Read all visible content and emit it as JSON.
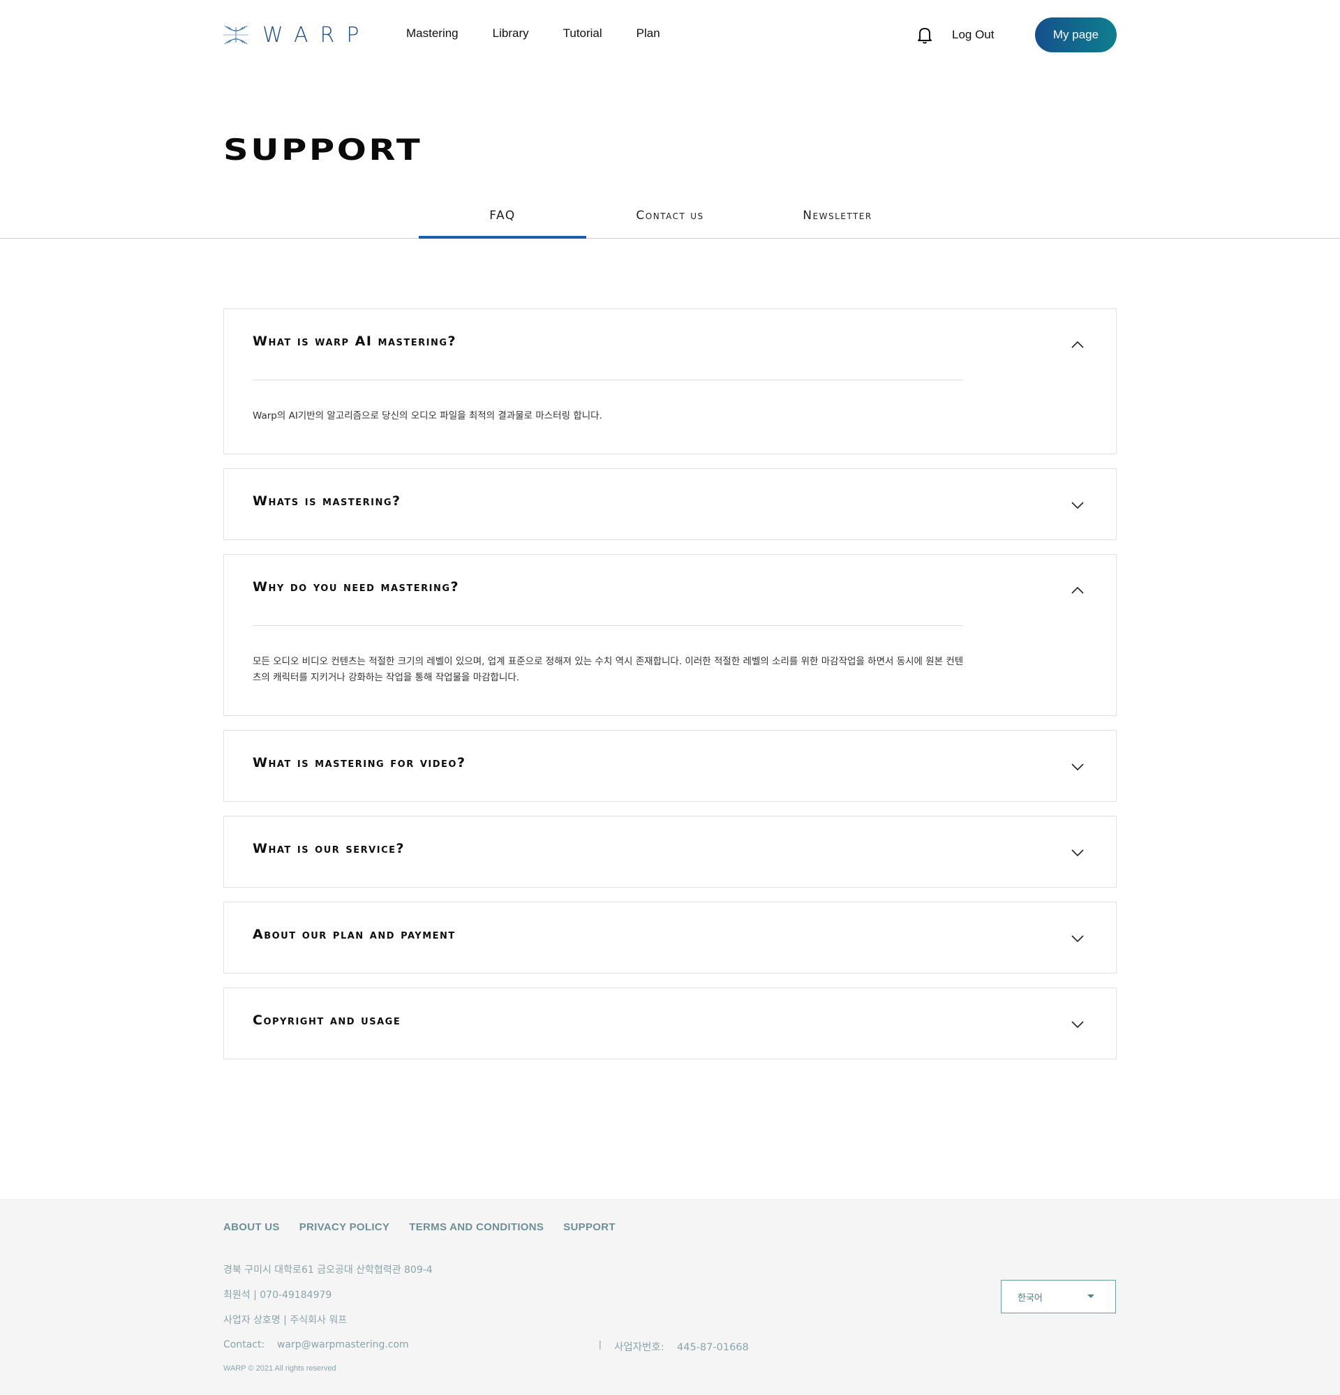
{
  "header": {
    "logo_text": "WARP",
    "nav": [
      "Mastering",
      "Library",
      "Tutorial",
      "Plan"
    ],
    "logout_label": "Log Out",
    "mypage_label": "My page",
    "icons": [
      "warp-logo-icon",
      "bell-icon"
    ]
  },
  "page_title": "SUPPORT",
  "tabs": [
    {
      "label": "FAQ",
      "active": true
    },
    {
      "label": "Contact us",
      "active": false
    },
    {
      "label": "Newsletter",
      "active": false
    }
  ],
  "faq": [
    {
      "question": "What is warp AI mastering?",
      "expanded": true,
      "answer": "Warp의 AI기반의 알고리즘으로 당신의 오디오 파일을 최적의 결과물로 마스터링 합니다."
    },
    {
      "question": "Whats is mastering?",
      "expanded": false,
      "answer": ""
    },
    {
      "question": "Why do you need mastering?",
      "expanded": true,
      "answer": "모든 오디오 비디오 컨텐츠는 적절한 크기의 레벨이 있으며, 업계 표준으로 정해져 있는 수치 역시 존재합니다. 이러한 적절한 레벨의 소리를 위한 마감작업을 하면서 동시에 원본 컨텐츠의 캐릭터를 지키거나 강화하는 작업을 통해 작업물을 마감합니다."
    },
    {
      "question": "What is mastering for video?",
      "expanded": false,
      "answer": ""
    },
    {
      "question": "What is our service?",
      "expanded": false,
      "answer": ""
    },
    {
      "question": "About our plan and payment",
      "expanded": false,
      "answer": ""
    },
    {
      "question": "Copyright and usage",
      "expanded": false,
      "answer": ""
    }
  ],
  "footer": {
    "links": [
      "ABOUT US",
      "PRIVACY POLICY",
      "TERMS AND CONDITIONS",
      "SUPPORT"
    ],
    "address": "경북 구미시 대학로61 금오공대 산학협력관 809-4",
    "ceo_phone": "최원석 | 070-49184979",
    "company": "사업자 상호명 | 주식회사 워프",
    "contact": "Contact:    warp@warpmastering.com",
    "separator": "|",
    "business_no": "사업자번호:    445-87-01668",
    "copyright": "WARP © 2021 All rights reserved",
    "language": "한국어"
  },
  "colors": {
    "brand_blue": "#1d4f8f",
    "tab_active": "#1b5eb0",
    "button_gradient_start": "#15508d",
    "button_gradient_end": "#0f7f8e",
    "footer_text": "#8aa4aa"
  }
}
